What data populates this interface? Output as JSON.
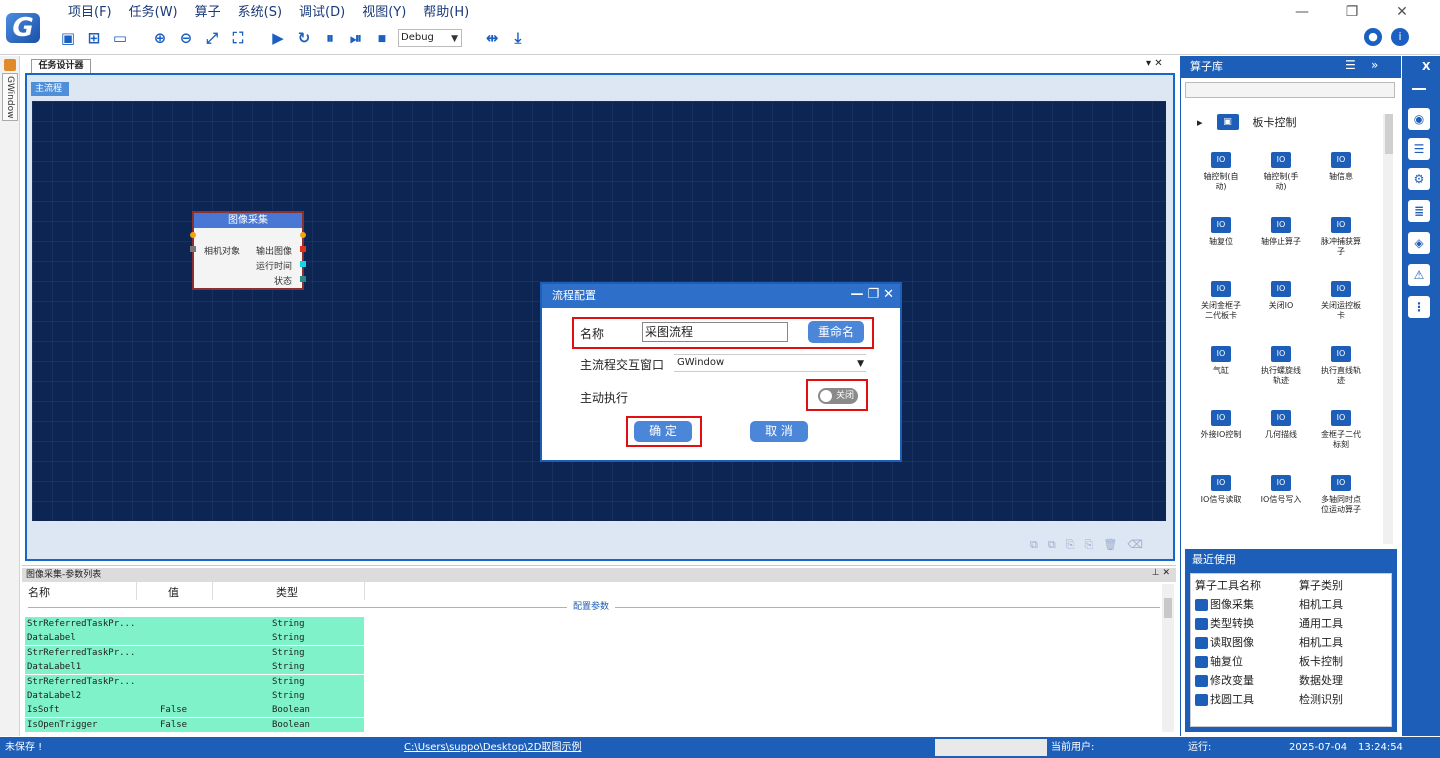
{
  "menu": [
    "项目(F)",
    "任务(W)",
    "算子",
    "系统(S)",
    "调试(D)",
    "视图(Y)",
    "帮助(H)"
  ],
  "logo": {
    "letter": "G"
  },
  "toolbar": {
    "debug_mode": "Debug",
    "icons": [
      "save-icon",
      "new-icon",
      "open-icon",
      "zoom-in-icon",
      "zoom-out-icon",
      "fit-icon",
      "fullscreen-icon",
      "run-icon",
      "loop-icon",
      "pause-icon",
      "step-icon",
      "stop-icon"
    ],
    "extra_icons": [
      "split-icon",
      "download-icon"
    ]
  },
  "window": {
    "minimize": "—",
    "restore": "❐",
    "close": "✕"
  },
  "left_strip": {
    "tab_label": "GWindow"
  },
  "document": {
    "tab": "任务设计器",
    "sub_tab": "主流程"
  },
  "node": {
    "title": "图像采集",
    "input": "相机对象",
    "outputs": [
      "输出图像",
      "运行时间",
      "状态"
    ]
  },
  "dialog": {
    "title": "流程配置",
    "name_label": "名称",
    "name_value": "采图流程",
    "rename_button": "重命名",
    "window_label": "主流程交互窗口",
    "window_value": "GWindow",
    "auto_exec_label": "主动执行",
    "toggle_text": "关闭",
    "ok_button": "确 定",
    "cancel_button": "取 消"
  },
  "params": {
    "title": "图像采集-参数列表",
    "headers": [
      "名称",
      "值",
      "类型"
    ],
    "group": "配置参数",
    "rows": [
      {
        "name": "StrReferredTaskPr...",
        "value": "",
        "type": "String"
      },
      {
        "name": "DataLabel",
        "value": "",
        "type": "String"
      },
      {
        "name": "StrReferredTaskPr...",
        "value": "",
        "type": "String"
      },
      {
        "name": "DataLabel1",
        "value": "",
        "type": "String"
      },
      {
        "name": "StrReferredTaskPr...",
        "value": "",
        "type": "String"
      },
      {
        "name": "DataLabel2",
        "value": "",
        "type": "String"
      },
      {
        "name": "IsSoft",
        "value": "False",
        "type": "Boolean"
      },
      {
        "name": "IsOpenTrigger",
        "value": "False",
        "type": "Boolean"
      }
    ]
  },
  "operator_lib": {
    "title": "算子库",
    "category": "板卡控制",
    "items": [
      [
        "轴控制(自",
        "动)"
      ],
      [
        "轴控制(手",
        "动)"
      ],
      [
        "轴信息"
      ],
      [
        "轴复位"
      ],
      [
        "轴停止算子"
      ],
      [
        "脉冲捕获算",
        "子"
      ],
      [
        "关闭金框子",
        "二代板卡"
      ],
      [
        "关闭IO"
      ],
      [
        "关闭运控板",
        "卡"
      ],
      [
        "气缸"
      ],
      [
        "执行螺旋线",
        "轨迹"
      ],
      [
        "执行直线轨",
        "迹"
      ],
      [
        "外接IO控制"
      ],
      [
        "几何描线"
      ],
      [
        "金框子二代",
        "标刻"
      ],
      [
        "IO信号读取"
      ],
      [
        "IO信号写入"
      ],
      [
        "多轴同时点",
        "位运动算子"
      ]
    ]
  },
  "recent": {
    "title": "最近使用",
    "headers": [
      "算子工具名称",
      "算子类别"
    ],
    "rows": [
      [
        "图像采集",
        "相机工具"
      ],
      [
        "类型转换",
        "通用工具"
      ],
      [
        "读取图像",
        "相机工具"
      ],
      [
        "轴复位",
        "板卡控制"
      ],
      [
        "修改变量",
        "数据处理"
      ],
      [
        "找圆工具",
        "检测识别"
      ]
    ]
  },
  "status": {
    "saved": "未保存 !",
    "path": "C:\\Users\\suppo\\Desktop\\2D取图示例",
    "user_label": "当前用户:",
    "run_label": "运行:",
    "date": "2025-07-04",
    "time": "13:24:54"
  }
}
